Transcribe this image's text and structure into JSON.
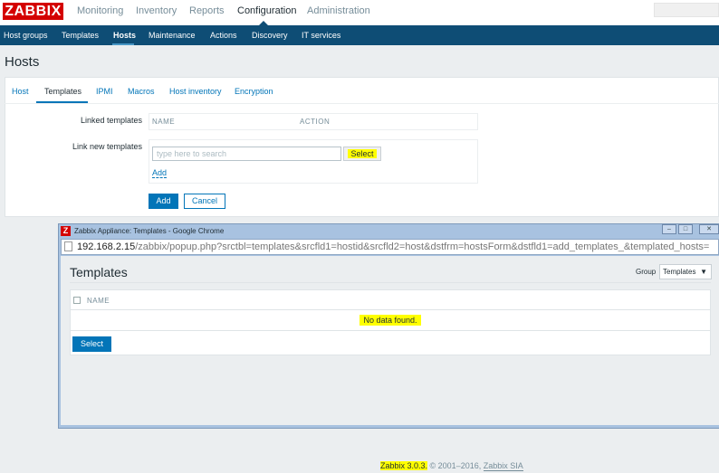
{
  "logo": "ZABBIX",
  "main_menu": [
    "Monitoring",
    "Inventory",
    "Reports",
    "Configuration",
    "Administration"
  ],
  "sub_menu": [
    "Host groups",
    "Templates",
    "Hosts",
    "Maintenance",
    "Actions",
    "Discovery",
    "IT services"
  ],
  "page_title": "Hosts",
  "tabs": [
    "Host",
    "Templates",
    "IPMI",
    "Macros",
    "Host inventory",
    "Encryption"
  ],
  "form": {
    "linked_label": "Linked templates",
    "col_name": "NAME",
    "col_action": "ACTION",
    "link_new_label": "Link new templates",
    "search_placeholder": "type here to search",
    "select": "Select",
    "add_link": "Add",
    "add": "Add",
    "cancel": "Cancel"
  },
  "popup": {
    "window_title": "Zabbix Appliance: Templates - Google Chrome",
    "url_host": "192.168.2.15",
    "url_path": "/zabbix/popup.php?srctbl=templates&srcfld1=hostid&srcfld2=host&dstfrm=hostsForm&dstfld1=add_templates_&templated_hosts=",
    "title": "Templates",
    "group_label": "Group",
    "group_value": "Templates",
    "col_name": "NAME",
    "no_data": "No data found.",
    "select": "Select"
  },
  "footer": {
    "version": "Zabbix 3.0.3.",
    "copyright": " © 2001–2016, ",
    "company": "Zabbix SIA"
  }
}
